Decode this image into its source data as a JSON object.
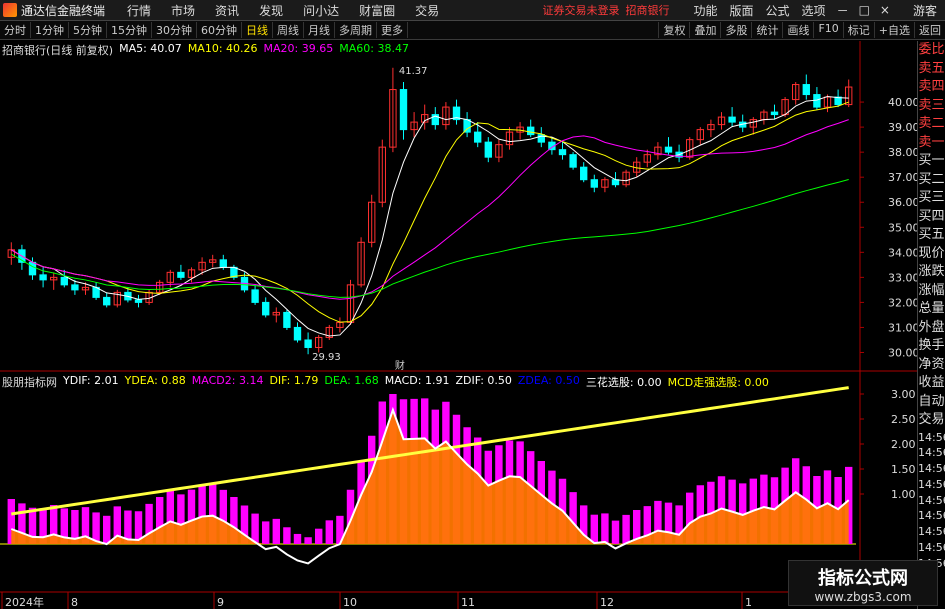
{
  "app": {
    "title": "通达信金融终端",
    "notice": "证券交易未登录",
    "bank": "招商银行",
    "guest": "游客"
  },
  "menu": [
    "行情",
    "市场",
    "资讯",
    "发现",
    "问小达",
    "财富圈",
    "交易"
  ],
  "right_menu": [
    "功能",
    "版面",
    "公式",
    "选项"
  ],
  "window_controls": [
    "－",
    "□",
    "×"
  ],
  "periods": [
    "分时",
    "1分钟",
    "5分钟",
    "15分钟",
    "30分钟",
    "60分钟",
    "日线",
    "周线",
    "月线",
    "多周期",
    "更多"
  ],
  "active_period": "日线",
  "toolbar_right": [
    "复权",
    "叠加",
    "多股",
    "统计",
    "画线",
    "F10",
    "标记",
    "+自选",
    "返回"
  ],
  "stock_info": {
    "name": "招商银行(日线 前复权)",
    "ma5": "MA5: 40.07",
    "ma10": "MA10: 40.26",
    "ma20": "MA20: 39.65",
    "ma60": "MA60: 38.47"
  },
  "colors": {
    "ma5": "#ffffff",
    "ma10": "#ffff00",
    "ma20": "#ff00ff",
    "ma60": "#00ff00",
    "up": "#ff3030",
    "down": "#00ffff",
    "macd_bar": "#ff00ff",
    "orange": "#ff7700",
    "lime": "#00ff00"
  },
  "price_labels": [
    "40.00",
    "39.00",
    "38.00",
    "37.00",
    "36.00",
    "35.00",
    "34.00",
    "33.00",
    "32.00",
    "31.00",
    "30.00"
  ],
  "high_label": "41.37",
  "low_label": "29.93",
  "fin_marker": "财",
  "indicator_info": {
    "name": "股朋指标网",
    "items": [
      {
        "text": "YDIF: 2.01",
        "color": "#ffffff"
      },
      {
        "text": "YDEA: 0.88",
        "color": "#ffff00"
      },
      {
        "text": "MACD2: 3.14",
        "color": "#ff00ff"
      },
      {
        "text": "DIF: 1.79",
        "color": "#ffff00"
      },
      {
        "text": "DEA: 1.68",
        "color": "#00ff00"
      },
      {
        "text": "MACD: 1.91",
        "color": "#ffffff"
      },
      {
        "text": "ZDIF: 0.50",
        "color": "#ffffff"
      },
      {
        "text": "ZDEA: 0.50",
        "color": "#0000ff"
      },
      {
        "text": "三花选股: 0.00",
        "color": "#ffffff"
      },
      {
        "text": "MCD走强选股: 0.00",
        "color": "#ffff00"
      }
    ]
  },
  "indicator_labels": [
    "3.00",
    "2.50",
    "2.00",
    "1.50",
    "1.00"
  ],
  "date_labels": [
    "2024年",
    "8",
    "9",
    "10",
    "11",
    "12",
    "1"
  ],
  "side_items": [
    "委比",
    "卖五",
    "卖四",
    "卖三",
    "卖二",
    "卖一",
    "买一",
    "买二",
    "买三",
    "买四",
    "买五",
    "现价",
    "涨跌",
    "涨幅",
    "总量",
    "外盘",
    "换手",
    "净资",
    "收益",
    "自动",
    "交易"
  ],
  "side_times": [
    "14:56",
    "14:56",
    "14:56",
    "14:56",
    "14:56",
    "14:56",
    "14:56",
    "14:56",
    "14:56"
  ],
  "axis_top": "L  R",
  "watermark": {
    "line1": "指标公式网",
    "line2": "www.zbgs3.com"
  },
  "chart_data": {
    "type": "candlestick",
    "ylim": [
      29.5,
      41.8
    ],
    "ohlc": [
      [
        33.8,
        34.4,
        33.5,
        34.1
      ],
      [
        34.1,
        34.3,
        33.3,
        33.6
      ],
      [
        33.6,
        33.8,
        32.9,
        33.1
      ],
      [
        33.1,
        33.4,
        32.6,
        32.9
      ],
      [
        32.9,
        33.2,
        32.5,
        33.0
      ],
      [
        33.0,
        33.3,
        32.6,
        32.7
      ],
      [
        32.7,
        32.9,
        32.3,
        32.5
      ],
      [
        32.5,
        32.8,
        32.3,
        32.6
      ],
      [
        32.6,
        32.8,
        32.1,
        32.2
      ],
      [
        32.2,
        32.4,
        31.8,
        31.9
      ],
      [
        31.9,
        32.5,
        31.8,
        32.4
      ],
      [
        32.4,
        32.6,
        32.0,
        32.1
      ],
      [
        32.1,
        32.3,
        31.8,
        32.0
      ],
      [
        32.0,
        32.5,
        31.9,
        32.4
      ],
      [
        32.4,
        32.9,
        32.3,
        32.8
      ],
      [
        32.8,
        33.3,
        32.6,
        33.2
      ],
      [
        33.2,
        33.5,
        32.9,
        33.0
      ],
      [
        33.0,
        33.4,
        32.8,
        33.3
      ],
      [
        33.3,
        33.8,
        33.1,
        33.6
      ],
      [
        33.6,
        33.9,
        33.4,
        33.7
      ],
      [
        33.7,
        33.9,
        33.3,
        33.4
      ],
      [
        33.4,
        33.5,
        32.9,
        33.0
      ],
      [
        33.0,
        33.2,
        32.4,
        32.5
      ],
      [
        32.5,
        32.7,
        31.9,
        32.0
      ],
      [
        32.0,
        32.2,
        31.4,
        31.5
      ],
      [
        31.5,
        31.8,
        31.2,
        31.6
      ],
      [
        31.6,
        31.7,
        30.9,
        31.0
      ],
      [
        31.0,
        31.2,
        30.4,
        30.5
      ],
      [
        30.5,
        30.8,
        29.93,
        30.2
      ],
      [
        30.2,
        30.7,
        30.0,
        30.6
      ],
      [
        30.6,
        31.1,
        30.5,
        31.0
      ],
      [
        31.0,
        31.4,
        30.8,
        31.2
      ],
      [
        31.2,
        32.9,
        31.1,
        32.7
      ],
      [
        32.7,
        34.6,
        32.6,
        34.4
      ],
      [
        34.4,
        36.3,
        34.2,
        36.0
      ],
      [
        36.0,
        38.5,
        35.8,
        38.2
      ],
      [
        38.2,
        41.37,
        38.0,
        40.5
      ],
      [
        40.5,
        40.8,
        38.5,
        38.9
      ],
      [
        38.9,
        39.6,
        38.6,
        39.2
      ],
      [
        39.2,
        39.9,
        38.9,
        39.5
      ],
      [
        39.5,
        39.8,
        38.9,
        39.1
      ],
      [
        39.1,
        40.0,
        38.9,
        39.8
      ],
      [
        39.8,
        40.1,
        39.1,
        39.3
      ],
      [
        39.3,
        39.6,
        38.6,
        38.8
      ],
      [
        38.8,
        39.2,
        38.2,
        38.4
      ],
      [
        38.4,
        38.6,
        37.6,
        37.8
      ],
      [
        37.8,
        38.5,
        37.6,
        38.3
      ],
      [
        38.3,
        39.0,
        38.1,
        38.8
      ],
      [
        38.8,
        39.2,
        38.5,
        39.0
      ],
      [
        39.0,
        39.3,
        38.6,
        38.7
      ],
      [
        38.7,
        39.0,
        38.2,
        38.4
      ],
      [
        38.4,
        38.6,
        37.9,
        38.1
      ],
      [
        38.1,
        38.4,
        37.7,
        37.9
      ],
      [
        37.9,
        38.0,
        37.3,
        37.4
      ],
      [
        37.4,
        37.6,
        36.8,
        36.9
      ],
      [
        36.9,
        37.1,
        36.4,
        36.6
      ],
      [
        36.6,
        37.0,
        36.4,
        36.9
      ],
      [
        36.9,
        37.2,
        36.6,
        36.7
      ],
      [
        36.7,
        37.3,
        36.6,
        37.2
      ],
      [
        37.2,
        37.8,
        37.0,
        37.6
      ],
      [
        37.6,
        38.1,
        37.4,
        37.9
      ],
      [
        37.9,
        38.4,
        37.7,
        38.2
      ],
      [
        38.2,
        38.6,
        37.9,
        38.0
      ],
      [
        38.0,
        38.3,
        37.6,
        37.8
      ],
      [
        37.8,
        38.6,
        37.7,
        38.5
      ],
      [
        38.5,
        39.0,
        38.3,
        38.9
      ],
      [
        38.9,
        39.3,
        38.6,
        39.1
      ],
      [
        39.1,
        39.6,
        38.9,
        39.4
      ],
      [
        39.4,
        39.8,
        39.0,
        39.2
      ],
      [
        39.2,
        39.5,
        38.8,
        39.0
      ],
      [
        39.0,
        39.4,
        38.7,
        39.3
      ],
      [
        39.3,
        39.7,
        39.1,
        39.6
      ],
      [
        39.6,
        39.9,
        39.3,
        39.5
      ],
      [
        39.5,
        40.2,
        39.4,
        40.1
      ],
      [
        40.1,
        40.8,
        39.9,
        40.7
      ],
      [
        40.7,
        41.1,
        40.1,
        40.3
      ],
      [
        40.3,
        40.6,
        39.7,
        39.8
      ],
      [
        39.8,
        40.3,
        39.6,
        40.2
      ],
      [
        40.2,
        40.5,
        39.8,
        39.9
      ],
      [
        39.9,
        40.9,
        39.8,
        40.6
      ]
    ]
  }
}
